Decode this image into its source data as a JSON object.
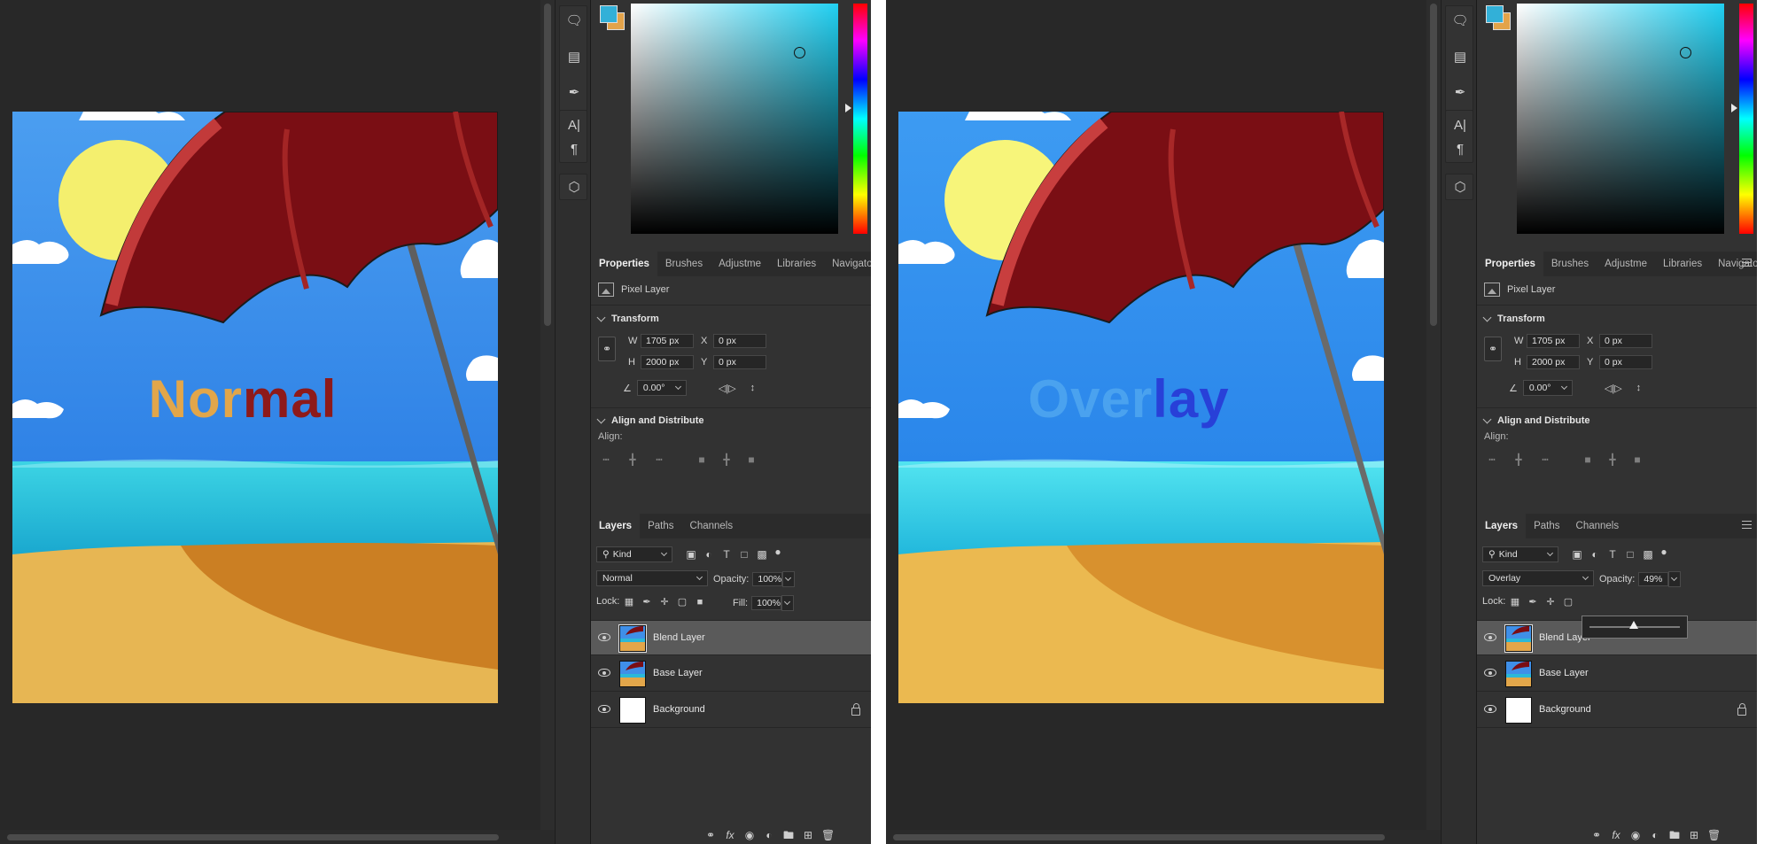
{
  "left": {
    "canvas": {
      "word_part1": "Nor",
      "word_part2": "mal"
    },
    "properties_tabs": [
      "Properties",
      "Brushes",
      "Adjustme",
      "Libraries",
      "Navigator"
    ],
    "properties": {
      "layer_type": "Pixel Layer",
      "transform_title": "Transform",
      "w_label": "W",
      "w_value": "1705 px",
      "h_label": "H",
      "h_value": "2000 px",
      "x_label": "X",
      "x_value": "0 px",
      "y_label": "Y",
      "y_value": "0 px",
      "angle_value": "0.00°",
      "align_title": "Align and Distribute",
      "align_label": "Align:"
    },
    "layers_tabs": [
      "Layers",
      "Paths",
      "Channels"
    ],
    "layers_panel": {
      "filter_kind": "Kind",
      "blend_mode": "Normal",
      "opacity_label": "Opacity:",
      "opacity_value": "100%",
      "lock_label": "Lock:",
      "fill_label": "Fill:",
      "fill_value": "100%",
      "layers": [
        {
          "name": "Blend Layer"
        },
        {
          "name": "Base Layer"
        },
        {
          "name": "Background"
        }
      ]
    }
  },
  "right": {
    "canvas": {
      "word_part1": "Over",
      "word_part2": "lay"
    },
    "properties_tabs": [
      "Properties",
      "Brushes",
      "Adjustme",
      "Libraries",
      "Navigator"
    ],
    "properties": {
      "layer_type": "Pixel Layer",
      "transform_title": "Transform",
      "w_label": "W",
      "w_value": "1705 px",
      "h_label": "H",
      "h_value": "2000 px",
      "x_label": "X",
      "x_value": "0 px",
      "y_label": "Y",
      "y_value": "0 px",
      "angle_value": "0.00°",
      "align_title": "Align and Distribute",
      "align_label": "Align:"
    },
    "layers_tabs": [
      "Layers",
      "Paths",
      "Channels"
    ],
    "layers_panel": {
      "filter_kind": "Kind",
      "blend_mode": "Overlay",
      "opacity_label": "Opacity:",
      "opacity_value": "49%",
      "opacity_slider_fraction": 0.49,
      "lock_label": "Lock:",
      "layers": [
        {
          "name": "Blend Layer"
        },
        {
          "name": "Base Layer"
        },
        {
          "name": "Background"
        }
      ]
    }
  },
  "colors": {
    "foreground": "#32b0d8",
    "background": "#e3a34a",
    "selected_layer": "#5a5a5a"
  },
  "icons": {
    "toolstrip": [
      "comment-icon",
      "ruler-icon",
      "brush-settings-icon",
      "character-icon",
      "paragraph-icon",
      "3d-cube-icon"
    ],
    "layer_footer": [
      "link-icon",
      "fx-icon",
      "mask-icon",
      "adjustment-icon",
      "group-folder-icon",
      "new-layer-icon",
      "trash-icon"
    ]
  }
}
